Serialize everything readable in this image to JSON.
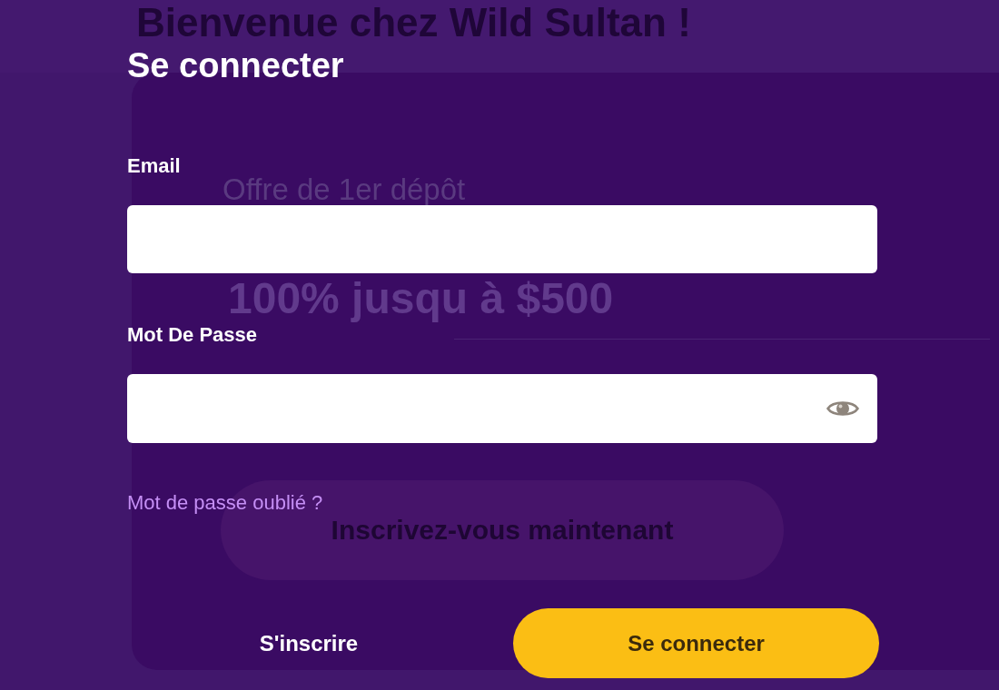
{
  "background_page": {
    "heading": "Bienvenue chez Wild Sultan !",
    "offer": {
      "label": "Offre de 1er dépôt",
      "amount": "100% jusqu à $500",
      "button": "Inscrivez-vous maintenant"
    }
  },
  "login_dialog": {
    "title": "Se connecter",
    "fields": [
      {
        "label": "Email",
        "kind": "email"
      },
      {
        "label": "Mot De Passe",
        "kind": "password"
      }
    ],
    "forgot_password_link": "Mot de passe oublié ?",
    "secondary_button": "S'inscrire",
    "primary_button": "Se connecter"
  }
}
